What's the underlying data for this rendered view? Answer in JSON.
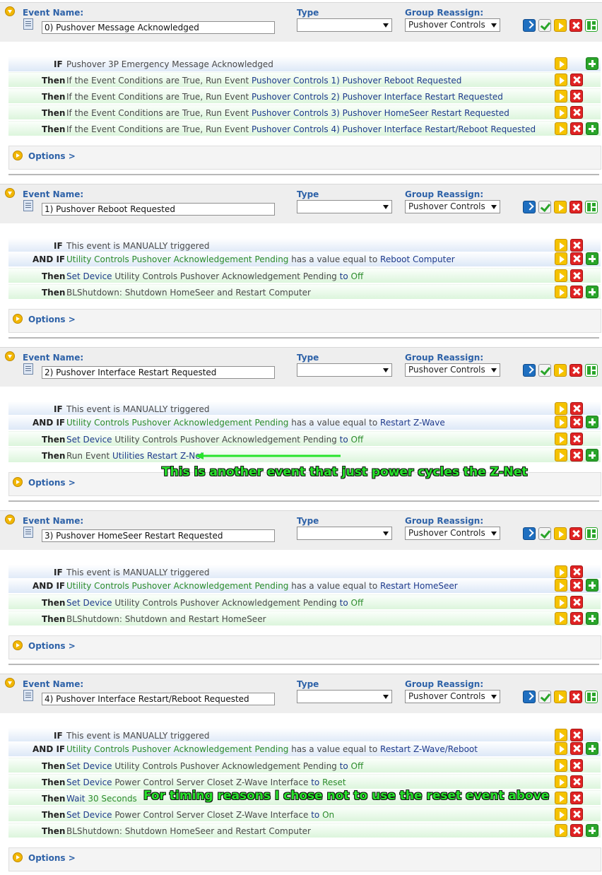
{
  "labels": {
    "event_name": "Event Name:",
    "type": "Type",
    "group_reassign": "Group Reassign:",
    "options": "Options >",
    "if": "IF",
    "and_if": "AND IF",
    "then": "Then"
  },
  "events": [
    {
      "name": "0) Pushover Message Acknowledged",
      "group": "Pushover Controls",
      "type": "",
      "rows": [
        {
          "kind": "IF",
          "parts": [
            [
              "plain",
              "Pushover 3P Emergency Message Acknowledged"
            ]
          ],
          "buttons": [
            "play",
            "add"
          ]
        },
        {
          "kind": "Then",
          "parts": [
            [
              "plain",
              "If the Event Conditions are True, Run Event "
            ],
            [
              "link",
              "Pushover Controls 1) Pushover Reboot Requested"
            ]
          ],
          "buttons": [
            "play",
            "del"
          ]
        },
        {
          "kind": "Then",
          "parts": [
            [
              "plain",
              "If the Event Conditions are True, Run Event "
            ],
            [
              "link",
              "Pushover Controls 2) Pushover Interface Restart Requested"
            ]
          ],
          "buttons": [
            "play",
            "del"
          ]
        },
        {
          "kind": "Then",
          "parts": [
            [
              "plain",
              "If the Event Conditions are True, Run Event "
            ],
            [
              "link",
              "Pushover Controls 3) Pushover HomeSeer Restart Requested"
            ]
          ],
          "buttons": [
            "play",
            "del"
          ]
        },
        {
          "kind": "Then",
          "parts": [
            [
              "plain",
              "If the Event Conditions are True, Run Event "
            ],
            [
              "link",
              "Pushover Controls 4) Pushover Interface Restart/Reboot Requested"
            ]
          ],
          "buttons": [
            "play",
            "del",
            "add"
          ]
        }
      ]
    },
    {
      "name": "1) Pushover Reboot Requested",
      "group": "Pushover Controls",
      "type": "",
      "rows": [
        {
          "kind": "IF",
          "parts": [
            [
              "plain",
              "This event is MANUALLY triggered"
            ]
          ],
          "buttons": [
            "play",
            "del"
          ]
        },
        {
          "kind": "AND IF",
          "parts": [
            [
              "green",
              "Utility Controls Pushover Acknowledgement Pending"
            ],
            [
              "plain",
              " has a value equal to "
            ],
            [
              "link",
              "Reboot Computer"
            ]
          ],
          "buttons": [
            "play",
            "del",
            "add"
          ]
        },
        {
          "kind": "Then",
          "parts": [
            [
              "link",
              "Set Device "
            ],
            [
              "plain",
              "Utility Controls Pushover Acknowledgement Pending "
            ],
            [
              "link",
              "to "
            ],
            [
              "green",
              "Off"
            ]
          ],
          "buttons": [
            "play",
            "del"
          ]
        },
        {
          "kind": "Then",
          "parts": [
            [
              "plain",
              "BLShutdown: Shutdown HomeSeer and Restart Computer"
            ]
          ],
          "buttons": [
            "play",
            "del",
            "add"
          ]
        }
      ]
    },
    {
      "name": "2) Pushover Interface Restart Requested",
      "group": "Pushover Controls",
      "type": "",
      "rows": [
        {
          "kind": "IF",
          "parts": [
            [
              "plain",
              "This event is MANUALLY triggered"
            ]
          ],
          "buttons": [
            "play",
            "del"
          ]
        },
        {
          "kind": "AND IF",
          "parts": [
            [
              "green",
              "Utility Controls Pushover Acknowledgement Pending"
            ],
            [
              "plain",
              " has a value equal to "
            ],
            [
              "link",
              "Restart Z-Wave"
            ]
          ],
          "buttons": [
            "play",
            "del",
            "add"
          ]
        },
        {
          "kind": "Then",
          "parts": [
            [
              "link",
              "Set Device "
            ],
            [
              "plain",
              "Utility Controls Pushover Acknowledgement Pending "
            ],
            [
              "link",
              "to "
            ],
            [
              "green",
              "Off"
            ]
          ],
          "buttons": [
            "play",
            "del"
          ]
        },
        {
          "kind": "Then",
          "parts": [
            [
              "plain",
              "Run Event "
            ],
            [
              "link",
              "Utilities Restart Z-Net"
            ]
          ],
          "buttons": [
            "play",
            "del",
            "add"
          ]
        }
      ]
    },
    {
      "name": "3) Pushover HomeSeer Restart Requested",
      "group": "Pushover Controls",
      "type": "",
      "rows": [
        {
          "kind": "IF",
          "parts": [
            [
              "plain",
              "This event is MANUALLY triggered"
            ]
          ],
          "buttons": [
            "play",
            "del"
          ]
        },
        {
          "kind": "AND IF",
          "parts": [
            [
              "green",
              "Utility Controls Pushover Acknowledgement Pending"
            ],
            [
              "plain",
              " has a value equal to "
            ],
            [
              "link",
              "Restart HomeSeer"
            ]
          ],
          "buttons": [
            "play",
            "del",
            "add"
          ]
        },
        {
          "kind": "Then",
          "parts": [
            [
              "link",
              "Set Device "
            ],
            [
              "plain",
              "Utility Controls Pushover Acknowledgement Pending "
            ],
            [
              "link",
              "to "
            ],
            [
              "green",
              "Off"
            ]
          ],
          "buttons": [
            "play",
            "del"
          ]
        },
        {
          "kind": "Then",
          "parts": [
            [
              "plain",
              "BLShutdown: Shutdown and Restart HomeSeer"
            ]
          ],
          "buttons": [
            "play",
            "del",
            "add"
          ]
        }
      ]
    },
    {
      "name": "4) Pushover Interface Restart/Reboot Requested",
      "group": "Pushover Controls",
      "type": "",
      "rows": [
        {
          "kind": "IF",
          "parts": [
            [
              "plain",
              "This event is MANUALLY triggered"
            ]
          ],
          "buttons": [
            "play",
            "del"
          ]
        },
        {
          "kind": "AND IF",
          "parts": [
            [
              "green",
              "Utility Controls Pushover Acknowledgement Pending"
            ],
            [
              "plain",
              " has a value equal to "
            ],
            [
              "link",
              "Restart Z-Wave/Reboot"
            ]
          ],
          "buttons": [
            "play",
            "del",
            "add"
          ]
        },
        {
          "kind": "Then",
          "parts": [
            [
              "link",
              "Set Device "
            ],
            [
              "plain",
              "Utility Controls Pushover Acknowledgement Pending "
            ],
            [
              "link",
              "to "
            ],
            [
              "green",
              "Off"
            ]
          ],
          "buttons": [
            "play",
            "del"
          ]
        },
        {
          "kind": "Then",
          "parts": [
            [
              "link",
              "Set Device "
            ],
            [
              "plain",
              "Power Control Server Closet Z-Wave Interface "
            ],
            [
              "link",
              "to "
            ],
            [
              "green",
              "Reset"
            ]
          ],
          "buttons": [
            "play",
            "del"
          ]
        },
        {
          "kind": "Then",
          "parts": [
            [
              "link",
              "Wait "
            ],
            [
              "green",
              "30 Seconds"
            ]
          ],
          "buttons": [
            "play",
            "del"
          ]
        },
        {
          "kind": "Then",
          "parts": [
            [
              "link",
              "Set Device "
            ],
            [
              "plain",
              "Power Control Server Closet Z-Wave Interface "
            ],
            [
              "link",
              "to "
            ],
            [
              "green",
              "On"
            ]
          ],
          "buttons": [
            "play",
            "del"
          ]
        },
        {
          "kind": "Then",
          "parts": [
            [
              "plain",
              "BLShutdown: Shutdown HomeSeer and Restart Computer"
            ]
          ],
          "buttons": [
            "play",
            "del",
            "add"
          ]
        }
      ]
    }
  ],
  "annotations": {
    "znet_note": "This is another event that just power cycles the Z-Net",
    "timing_note": "For timing reasons I chose not to use the reset event above"
  },
  "colors": {
    "label_blue": "#2e62a8",
    "link_navy": "#1e3a8c",
    "value_green": "#2c8c2c",
    "annotation_green": "#27e42b",
    "if_row_bg": "#dde8f7",
    "then_row_bg": "#dcf5dc"
  }
}
